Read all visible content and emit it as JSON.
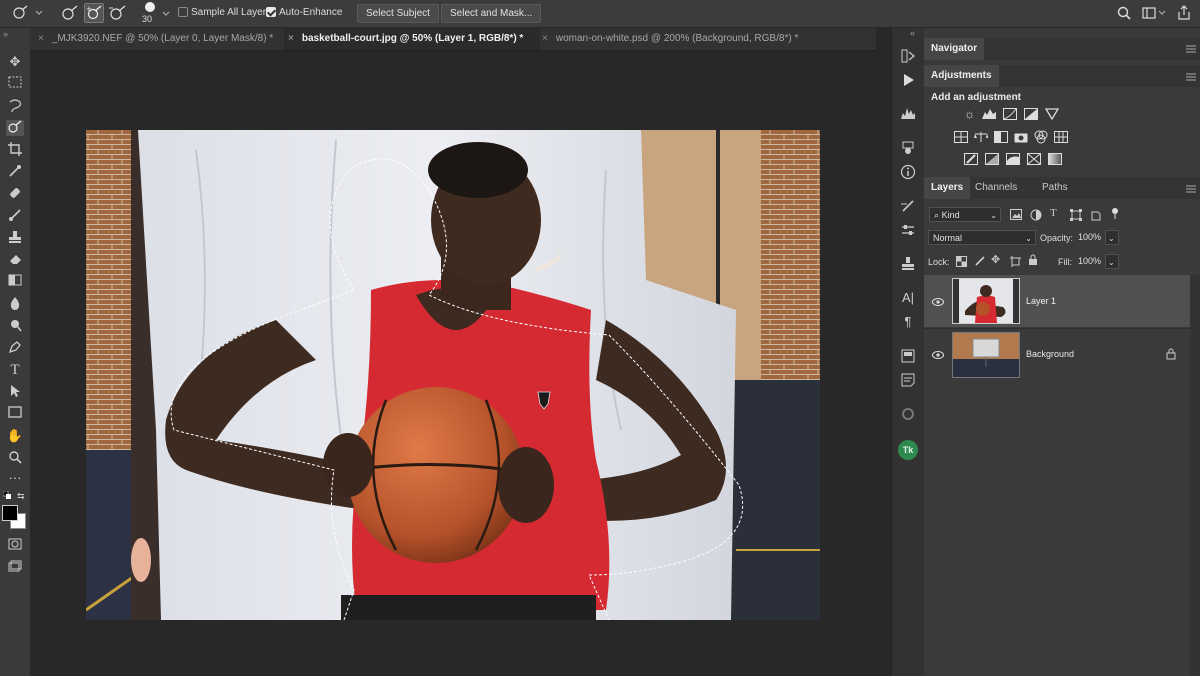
{
  "options_bar": {
    "brush_size": "30",
    "sample_all_layers_label": "Sample All Layers",
    "sample_all_layers_checked": false,
    "auto_enhance_label": "Auto-Enhance",
    "auto_enhance_checked": true,
    "select_subject_label": "Select Subject",
    "select_and_mask_label": "Select and Mask..."
  },
  "tabs": [
    {
      "label": "_MJK3920.NEF @ 50% (Layer 0, Layer Mask/8) *",
      "active": false
    },
    {
      "label": "basketball-court.jpg @ 50% (Layer 1, RGB/8*) *",
      "active": true
    },
    {
      "label": "woman-on-white.psd @ 200% (Background, RGB/8*) *",
      "active": false
    }
  ],
  "panels": {
    "navigator_label": "Navigator",
    "adjustments_label": "Adjustments",
    "add_adjustment_label": "Add an adjustment",
    "layer_tabs": [
      "Layers",
      "Channels",
      "Paths"
    ],
    "filter_kind_label": "Kind",
    "blend_mode": "Normal",
    "opacity_label": "Opacity:",
    "opacity_value": "100%",
    "lock_label": "Lock:",
    "fill_label": "Fill:",
    "fill_value": "100%",
    "layers": [
      {
        "name": "Layer 1",
        "selected": true,
        "locked": false
      },
      {
        "name": "Background",
        "selected": false,
        "locked": true
      }
    ]
  },
  "colors": {
    "app_bg": "#282828",
    "panel_bg": "#3a3a3a",
    "selection_highlight": "#505050",
    "jersey_red": "#d62a33"
  },
  "icons": {
    "toolbar": [
      "move-icon",
      "marquee-icon",
      "lasso-icon",
      "quick-selection-icon",
      "crop-icon",
      "eyedropper-icon",
      "healing-brush-icon",
      "brush-icon",
      "clone-stamp-icon",
      "eraser-icon",
      "gradient-icon",
      "blur-icon",
      "dodge-icon",
      "pen-icon",
      "type-icon",
      "path-selection-icon",
      "rectangle-icon",
      "hand-icon",
      "zoom-icon",
      "more-icon"
    ]
  }
}
